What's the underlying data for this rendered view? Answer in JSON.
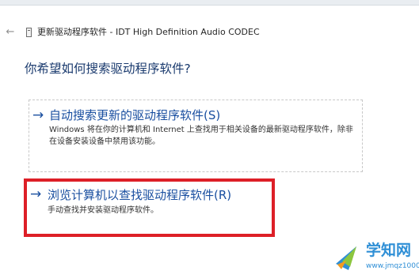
{
  "window": {
    "back_glyph": "←",
    "back_icon": "back-arrow-icon",
    "device_icon": "device-icon",
    "title": "更新驱动程序软件 - IDT High Definition Audio CODEC"
  },
  "prompt": {
    "heading": "你希望如何搜索驱动程序软件?"
  },
  "options": [
    {
      "arrow": "→",
      "icon": "right-arrow-icon",
      "title": "自动搜索更新的驱动程序软件(S)",
      "description": "Windows 将在你的计算机和 Internet 上查找用于相关设备的最新驱动程序软件，除非在设备安装设备中禁用该功能。"
    },
    {
      "arrow": "→",
      "icon": "right-arrow-icon",
      "title": "浏览计算机以查找驱动程序软件(R)",
      "description": "手动查找并安装驱动程序软件。"
    }
  ],
  "highlight": {
    "color": "#dd1f27"
  },
  "watermark": {
    "text": "学知网",
    "url": "www.jmqz1000.com",
    "color": "#2f8fd6"
  },
  "colors": {
    "link_blue": "#1a4fa0",
    "heading_blue": "#1a3a6e"
  }
}
